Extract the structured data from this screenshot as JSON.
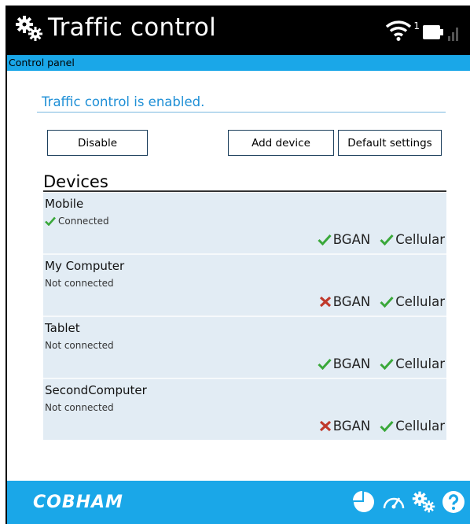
{
  "header": {
    "title": "Traffic control",
    "signal_superscript": "1"
  },
  "breadcrumb": "Control panel",
  "status_message": "Traffic control is enabled.",
  "buttons": {
    "disable": "Disable",
    "add_device": "Add device",
    "default_settings": "Default settings"
  },
  "devices_heading": "Devices",
  "devices": [
    {
      "name": "Mobile",
      "status": "Connected",
      "connected": true,
      "bgan": "BGAN",
      "bgan_enabled": true,
      "cellular": "Cellular",
      "cellular_enabled": true
    },
    {
      "name": "My Computer",
      "status": "Not connected",
      "connected": false,
      "bgan": "BGAN",
      "bgan_enabled": false,
      "cellular": "Cellular",
      "cellular_enabled": true
    },
    {
      "name": "Tablet",
      "status": "Not connected",
      "connected": false,
      "bgan": "BGAN",
      "bgan_enabled": true,
      "cellular": "Cellular",
      "cellular_enabled": true
    },
    {
      "name": "SecondComputer",
      "status": "Not connected",
      "connected": false,
      "bgan": "BGAN",
      "bgan_enabled": false,
      "cellular": "Cellular",
      "cellular_enabled": true
    }
  ],
  "footer": {
    "logo": "COBHAM",
    "icons": [
      "pie-chart-icon",
      "speedometer-icon",
      "settings-gears-icon",
      "help-icon"
    ]
  },
  "colors": {
    "header_bg": "#000000",
    "accent_blue": "#1aa7e8",
    "status_text": "#1e8fd6",
    "row_bg": "#e2ecf4",
    "check_green": "#3aa83a",
    "cross_red": "#c0392b"
  }
}
